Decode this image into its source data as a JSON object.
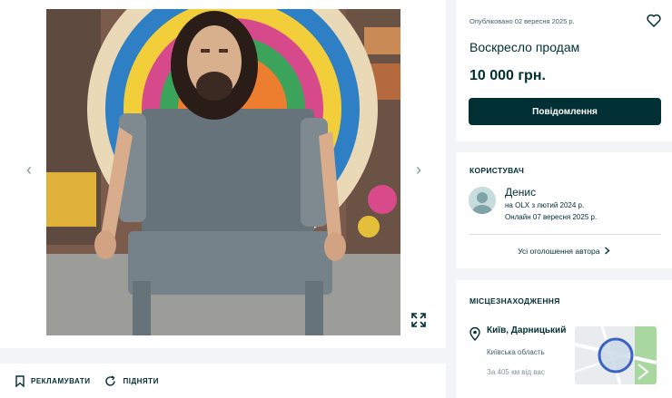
{
  "gallery": {
    "prev_arrow": "‹",
    "next_arrow": "›"
  },
  "actions": {
    "promote_label": "РЕКЛАМУВАТИ",
    "raise_label": "ПІДНЯТИ"
  },
  "offer": {
    "published": "Опубліковано 02 вересня 2025 р.",
    "title": "Воскресло продам",
    "price": "10 000 грн.",
    "message_button": "Повідомлення"
  },
  "user": {
    "heading": "КОРИСТУВАЧ",
    "name": "Денис",
    "since": "на OLX з лютий 2024 р.",
    "online": "Онлайн 07 вересня 2025 р.",
    "all_ads_link": "Усі оголошення автора"
  },
  "location": {
    "heading": "МІСЦЕЗНАХОДЖЕННЯ",
    "city": "Київ, Дарницький",
    "region": "Київська область",
    "distance": "За 405 км від вас"
  },
  "colors": {
    "primary": "#002f34",
    "page_bg": "#f2f4f5",
    "map_water": "#c9d9e6",
    "map_pin_ring": "#3b63c4"
  },
  "icons": [
    "chevron-left-icon",
    "chevron-right-icon",
    "expand-icon",
    "bookmark-icon",
    "refresh-icon",
    "heart-icon",
    "avatar-icon",
    "pin-icon",
    "chevron-right-small-icon"
  ]
}
